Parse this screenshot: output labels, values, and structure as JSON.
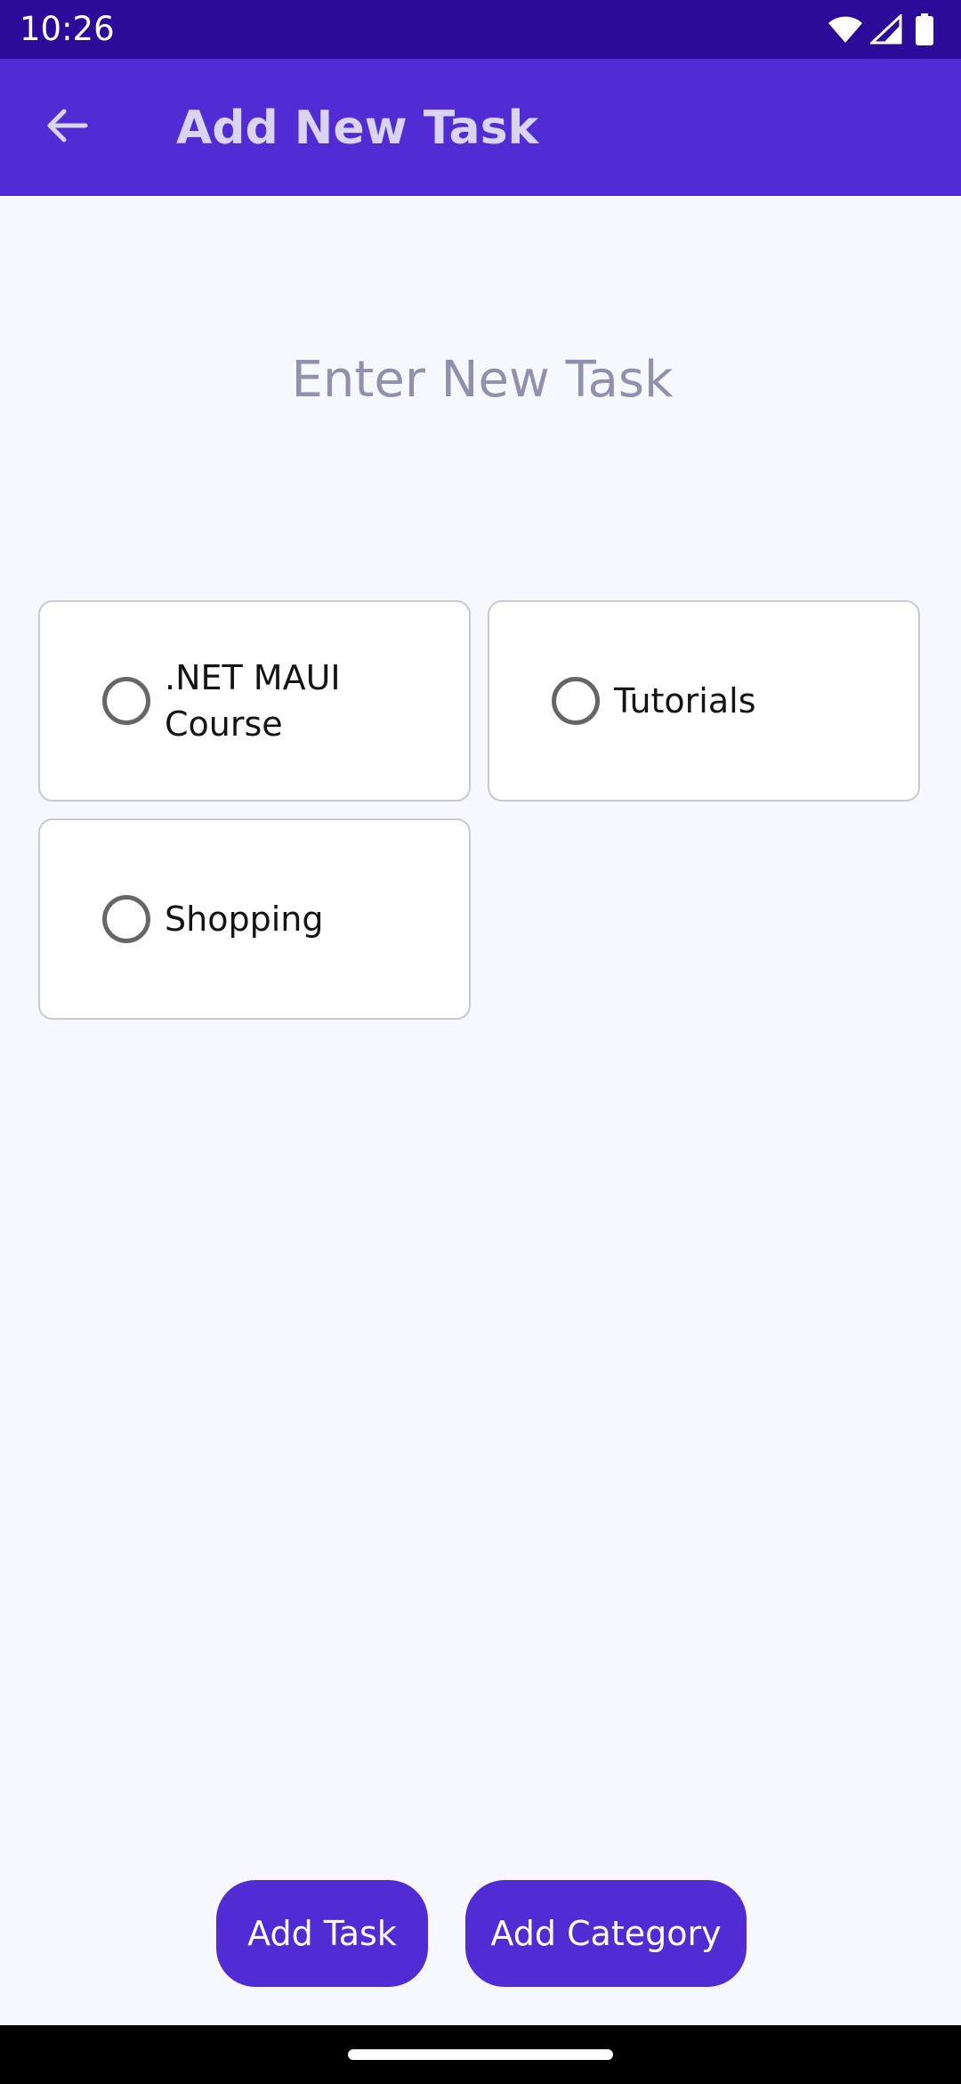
{
  "status_bar": {
    "time": "10:26",
    "icons": [
      "wifi-icon",
      "signal-icon",
      "battery-icon"
    ]
  },
  "app_bar": {
    "title": "Add New Task",
    "back_icon": "arrow-left-icon"
  },
  "task_entry": {
    "placeholder": "Enter New Task",
    "value": ""
  },
  "categories": [
    {
      "label": ".NET MAUI Course",
      "selected": false
    },
    {
      "label": "Tutorials",
      "selected": false
    },
    {
      "label": "Shopping",
      "selected": false
    }
  ],
  "buttons": {
    "add_task": "Add Task",
    "add_category": "Add Category"
  },
  "colors": {
    "status_bar": "#2B0B98",
    "primary": "#512BD4",
    "page_background": "#F7F8FE",
    "placeholder_text": "#8F91AD",
    "card_border": "#C9C9CE"
  }
}
